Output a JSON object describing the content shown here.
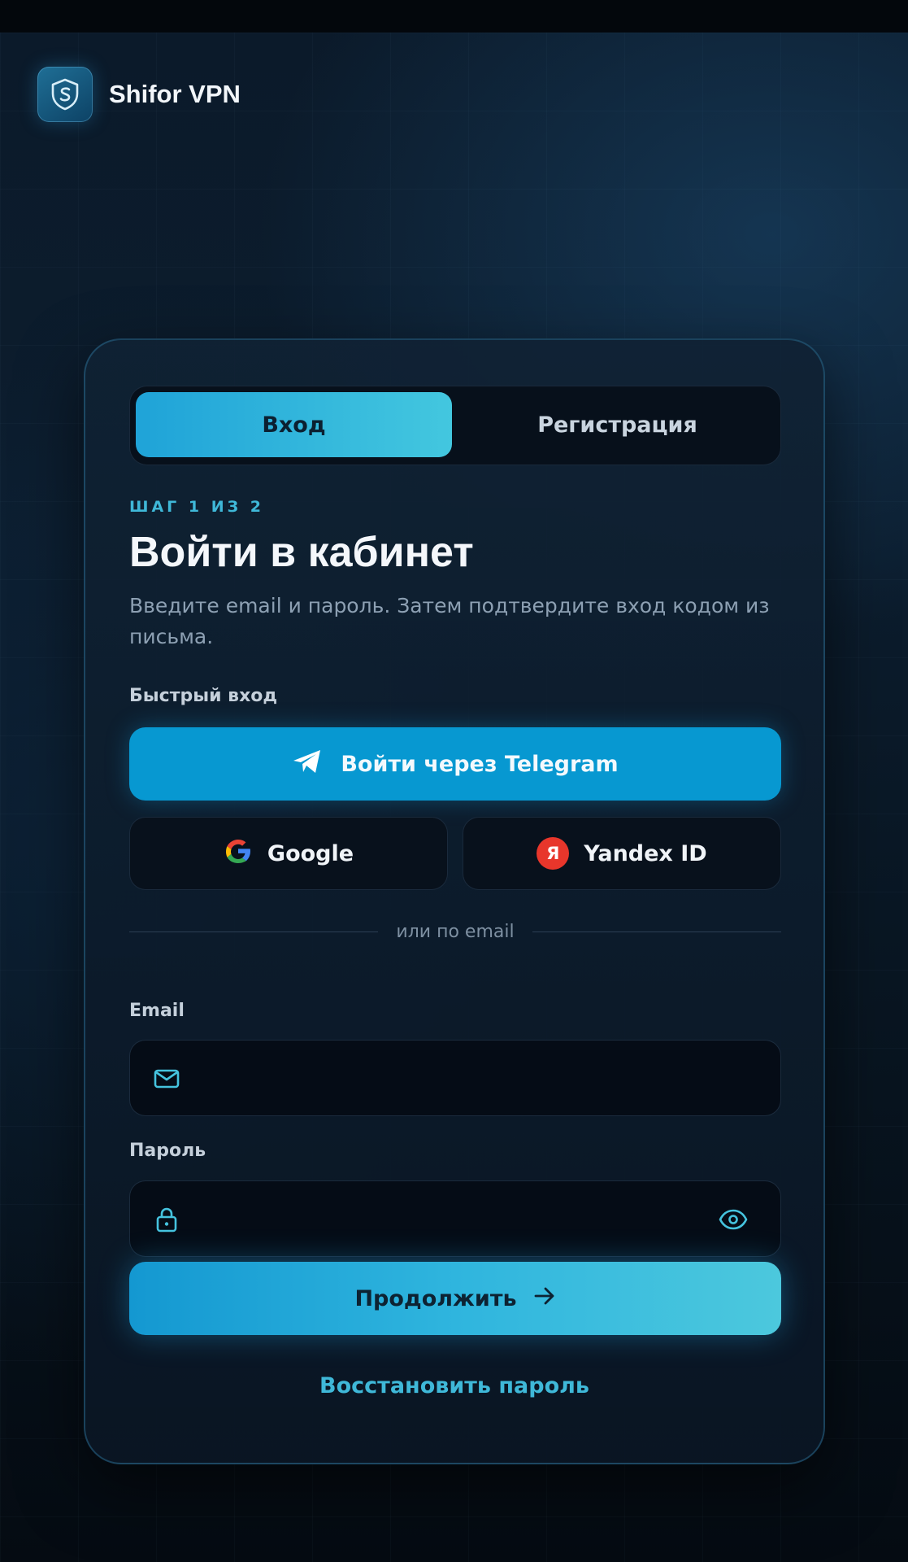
{
  "app": {
    "name": "Shifor VPN"
  },
  "auth": {
    "tabs": [
      {
        "label": "Вход",
        "active": true
      },
      {
        "label": "Регистрация",
        "active": false
      }
    ],
    "step": "ШАГ 1 ИЗ 2",
    "title": "Войти в кабинет",
    "subtitle": "Введите email и пароль. Затем подтвердите вход кодом из письма.",
    "quick_login_label": "Быстрый вход",
    "telegram_button": "Войти через Telegram",
    "google_button": "Google",
    "yandex_button": "Yandex ID",
    "yandex_badge": "Я",
    "divider_text": "или по email",
    "email_label": "Email",
    "email_value": "",
    "password_label": "Пароль",
    "password_value": "",
    "continue_button": "Продолжить",
    "restore_link": "Восстановить пароль"
  },
  "colors": {
    "accent": "#3fb8d8",
    "telegram": "#0798d1",
    "yandex": "#e8362b",
    "background": "#0b1a2a"
  },
  "icons": [
    "shield-logo-icon",
    "telegram-icon",
    "google-icon",
    "yandex-icon",
    "mail-icon",
    "lock-icon",
    "eye-icon",
    "arrow-right-icon"
  ]
}
